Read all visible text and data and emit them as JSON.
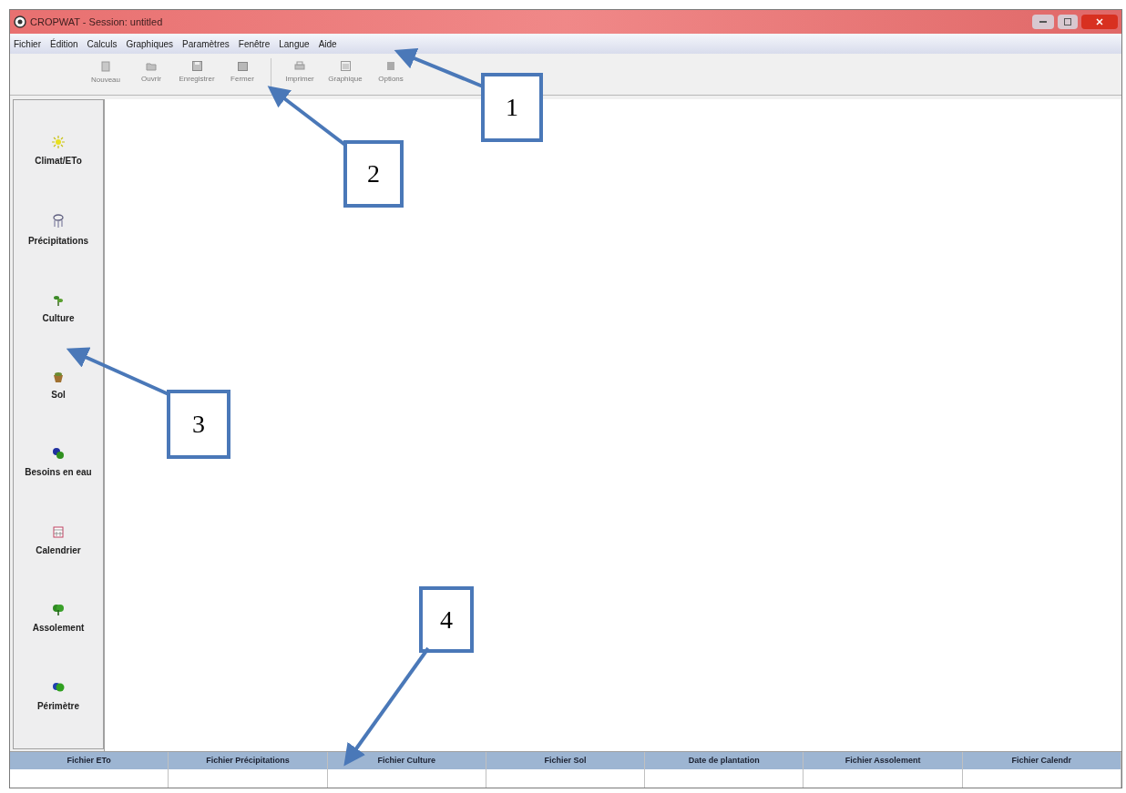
{
  "window": {
    "title": "CROPWAT - Session: untitled"
  },
  "menu": [
    "Fichier",
    "Édition",
    "Calculs",
    "Graphiques",
    "Paramètres",
    "Fenêtre",
    "Langue",
    "Aide"
  ],
  "toolbar": [
    {
      "label": "Nouveau",
      "disabled": true
    },
    {
      "label": "Ouvrir",
      "disabled": true
    },
    {
      "label": "Enregistrer",
      "disabled": true
    },
    {
      "label": "Fermer",
      "disabled": true
    },
    {
      "label": "Imprimer",
      "disabled": true
    },
    {
      "label": "Graphique",
      "disabled": true
    },
    {
      "label": "Options",
      "disabled": true
    }
  ],
  "sidebar": {
    "items": [
      "Climat/ETo",
      "Précipitations",
      "Culture",
      "Sol",
      "Besoins en eau",
      "Calendrier",
      "Assolement",
      "Périmètre"
    ]
  },
  "status_table": {
    "columns": [
      "Fichier ETo",
      "Fichier Précipitations",
      "Fichier Culture",
      "Fichier Sol",
      "Date de plantation",
      "Fichier Assolement",
      "Fichier Calendr"
    ]
  },
  "annotations": [
    "1",
    "2",
    "3",
    "4"
  ]
}
